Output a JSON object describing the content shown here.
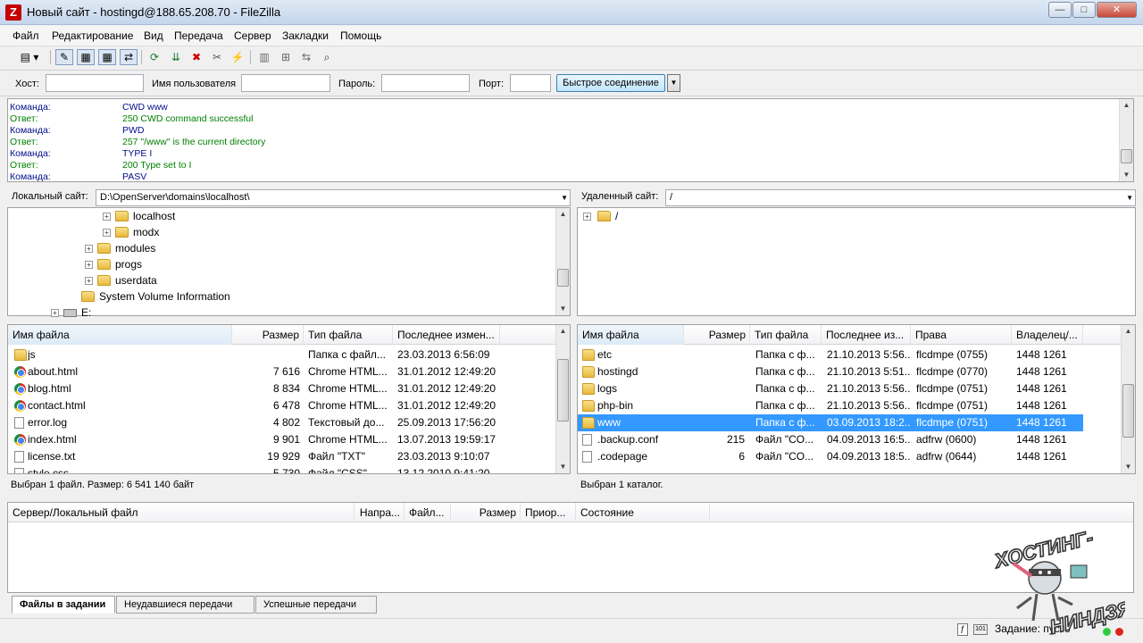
{
  "window": {
    "title": "Новый сайт - hostingd@188.65.208.70 - FileZilla",
    "app_icon": "Z",
    "minimize": "—",
    "maximize": "□",
    "close": "✕"
  },
  "menu": [
    "Файл",
    "Редактирование",
    "Вид",
    "Передача",
    "Сервер",
    "Закладки",
    "Помощь"
  ],
  "quickconnect": {
    "host_label": "Хост:",
    "host_value": "",
    "user_label": "Имя пользователя",
    "user_value": "",
    "pass_label": "Пароль:",
    "pass_value": "",
    "port_label": "Порт:",
    "port_value": "",
    "button": "Быстрое соединение"
  },
  "log": [
    {
      "type": "Команда:",
      "msg": "CWD www",
      "kind": "cmd"
    },
    {
      "type": "Ответ:",
      "msg": "250 CWD command successful",
      "kind": "ok"
    },
    {
      "type": "Команда:",
      "msg": "PWD",
      "kind": "cmd"
    },
    {
      "type": "Ответ:",
      "msg": "257 \"/www\" is the current directory",
      "kind": "ok"
    },
    {
      "type": "Команда:",
      "msg": "TYPE I",
      "kind": "cmd"
    },
    {
      "type": "Ответ:",
      "msg": "200 Type set to I",
      "kind": "ok"
    },
    {
      "type": "Команда:",
      "msg": "PASV",
      "kind": "cmd"
    }
  ],
  "local": {
    "site_label": "Локальный сайт:",
    "path": "D:\\OpenServer\\domains\\localhost\\",
    "tree": [
      {
        "name": "localhost",
        "expander": "+",
        "level": 3
      },
      {
        "name": "modx",
        "expander": "+",
        "level": 3
      },
      {
        "name": "modules",
        "expander": "+",
        "level": 2
      },
      {
        "name": "progs",
        "expander": "+",
        "level": 2
      },
      {
        "name": "userdata",
        "expander": "+",
        "level": 2
      },
      {
        "name": "System Volume Information",
        "expander": "",
        "level": 1
      },
      {
        "name": "E:",
        "expander": "+",
        "level": 0,
        "drive": true
      }
    ],
    "columns": [
      "Имя файла",
      "Размер",
      "Тип файла",
      "Последнее измен..."
    ],
    "files": [
      {
        "name": "js",
        "size": "",
        "type": "Папка с файл...",
        "modified": "23.03.2013 6:56:09",
        "icon": "folder"
      },
      {
        "name": "about.html",
        "size": "7 616",
        "type": "Chrome HTML...",
        "modified": "31.01.2012 12:49:20",
        "icon": "chrome"
      },
      {
        "name": "blog.html",
        "size": "8 834",
        "type": "Chrome HTML...",
        "modified": "31.01.2012 12:49:20",
        "icon": "chrome"
      },
      {
        "name": "contact.html",
        "size": "6 478",
        "type": "Chrome HTML...",
        "modified": "31.01.2012 12:49:20",
        "icon": "chrome"
      },
      {
        "name": "error.log",
        "size": "4 802",
        "type": "Текстовый до...",
        "modified": "25.09.2013 17:56:20",
        "icon": "doc"
      },
      {
        "name": "index.html",
        "size": "9 901",
        "type": "Chrome HTML...",
        "modified": "13.07.2013 19:59:17",
        "icon": "chrome"
      },
      {
        "name": "license.txt",
        "size": "19 929",
        "type": "Файл \"TXT\"",
        "modified": "23.03.2013 9:10:07",
        "icon": "doc"
      },
      {
        "name": "style.css",
        "size": "5 730",
        "type": "Файл \"CSS\"",
        "modified": "13.12.2010 9:41:20",
        "icon": "doc"
      }
    ],
    "status": "Выбран 1 файл. Размер: 6 541 140 байт"
  },
  "remote": {
    "site_label": "Удаленный сайт:",
    "path": "/",
    "tree": [
      {
        "name": "/",
        "expander": "+"
      }
    ],
    "columns": [
      "Имя файла",
      "Размер",
      "Тип файла",
      "Последнее из...",
      "Права",
      "Владелец/..."
    ],
    "files": [
      {
        "name": "etc",
        "size": "",
        "type": "Папка с ф...",
        "modified": "21.10.2013 5:56...",
        "perms": "flcdmpe (0755)",
        "owner": "1448 1261",
        "icon": "folder",
        "selected": false
      },
      {
        "name": "hostingd",
        "size": "",
        "type": "Папка с ф...",
        "modified": "21.10.2013 5:51...",
        "perms": "flcdmpe (0770)",
        "owner": "1448 1261",
        "icon": "folder",
        "selected": false
      },
      {
        "name": "logs",
        "size": "",
        "type": "Папка с ф...",
        "modified": "21.10.2013 5:56...",
        "perms": "flcdmpe (0751)",
        "owner": "1448 1261",
        "icon": "folder",
        "selected": false
      },
      {
        "name": "php-bin",
        "size": "",
        "type": "Папка с ф...",
        "modified": "21.10.2013 5:56...",
        "perms": "flcdmpe (0751)",
        "owner": "1448 1261",
        "icon": "folder",
        "selected": false
      },
      {
        "name": "www",
        "size": "",
        "type": "Папка с ф...",
        "modified": "03.09.2013 18:2...",
        "perms": "flcdmpe (0751)",
        "owner": "1448 1261",
        "icon": "folder",
        "selected": true
      },
      {
        "name": ".backup.conf",
        "size": "215",
        "type": "Файл \"CO...",
        "modified": "04.09.2013 16:5...",
        "perms": "adfrw (0600)",
        "owner": "1448 1261",
        "icon": "doc",
        "selected": false
      },
      {
        "name": ".codepage",
        "size": "6",
        "type": "Файл \"CO...",
        "modified": "04.09.2013 18:5...",
        "perms": "adfrw (0644)",
        "owner": "1448 1261",
        "icon": "doc",
        "selected": false
      }
    ],
    "status": "Выбран 1 каталог."
  },
  "queue": {
    "columns": [
      "Сервер/Локальный файл",
      "Напра...",
      "Файл...",
      "Размер",
      "Приор...",
      "Состояние"
    ],
    "tabs": [
      "Файлы в задании",
      "Неудавшиеся передачи",
      "Успешные передачи"
    ]
  },
  "statusbar": {
    "queue_text": "Задание: пусто"
  },
  "watermark": {
    "top": "ХОСТИНГ-",
    "bottom": "НИНДЗЯ"
  },
  "colors": {
    "selection": "#3399ff",
    "log_command": "#000c8a",
    "log_response": "#008000",
    "led_green": "#2ecc40",
    "led_red": "#e0241b"
  }
}
